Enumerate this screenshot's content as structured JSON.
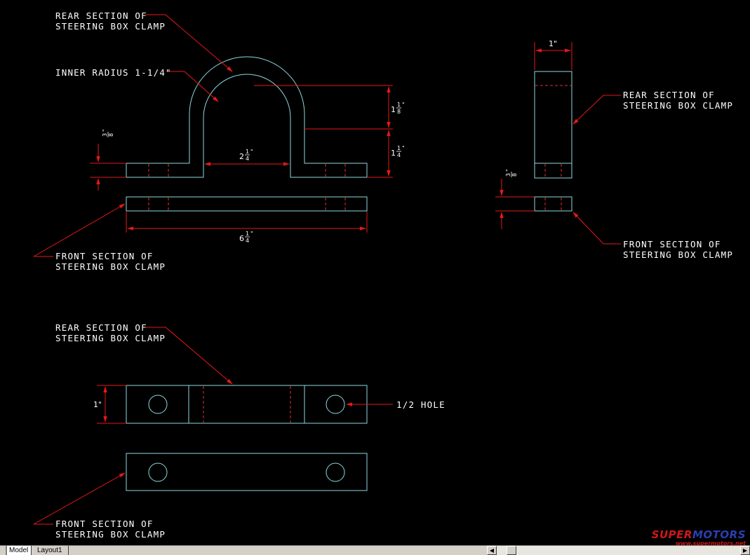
{
  "drawing": {
    "labels": {
      "rear_top_1": "REAR SECTION OF",
      "rear_top_2": "STEERING BOX CLAMP",
      "inner_radius": "INNER RADIUS 1-1/4\"",
      "front_top_1": "FRONT SECTION OF",
      "front_top_2": "STEERING BOX CLAMP",
      "rear_side_1": "REAR SECTION OF",
      "rear_side_2": "STEERING BOX CLAMP",
      "front_side_1": "FRONT SECTION OF",
      "front_side_2": "STEERING BOX CLAMP",
      "rear_plan_1": "REAR SECTION OF",
      "rear_plan_2": "STEERING BOX CLAMP",
      "hole": "1/2 HOLE",
      "front_plan_1": "FRONT SECTION OF",
      "front_plan_2": "STEERING BOX CLAMP"
    },
    "dimensions": {
      "arch_upper_whole": "1",
      "arch_upper_num": "1",
      "arch_upper_den": "8",
      "arch_lower_whole": "1",
      "arch_lower_num": "1",
      "arch_lower_den": "4",
      "inner_width_whole": "2",
      "inner_width_num": "1",
      "inner_width_den": "4",
      "overall_width_whole": "6",
      "overall_width_num": "1",
      "overall_width_den": "4",
      "thickness_num": "3",
      "thickness_den": "8",
      "side_thickness_num": "3",
      "side_thickness_den": "8",
      "side_width": "1\"",
      "plan_width": "1\""
    },
    "colors": {
      "background": "#000000",
      "object_line": "#8fd8e0",
      "dimension_line": "#e81818",
      "text": "#ffffff"
    }
  },
  "statusbar": {
    "tabs": [
      "Model",
      "Layout1"
    ],
    "active_tab": "Model"
  },
  "watermark": {
    "brand_red": "SUPER",
    "brand_blue": "MOTORS",
    "url": "www.supermotors.net"
  }
}
